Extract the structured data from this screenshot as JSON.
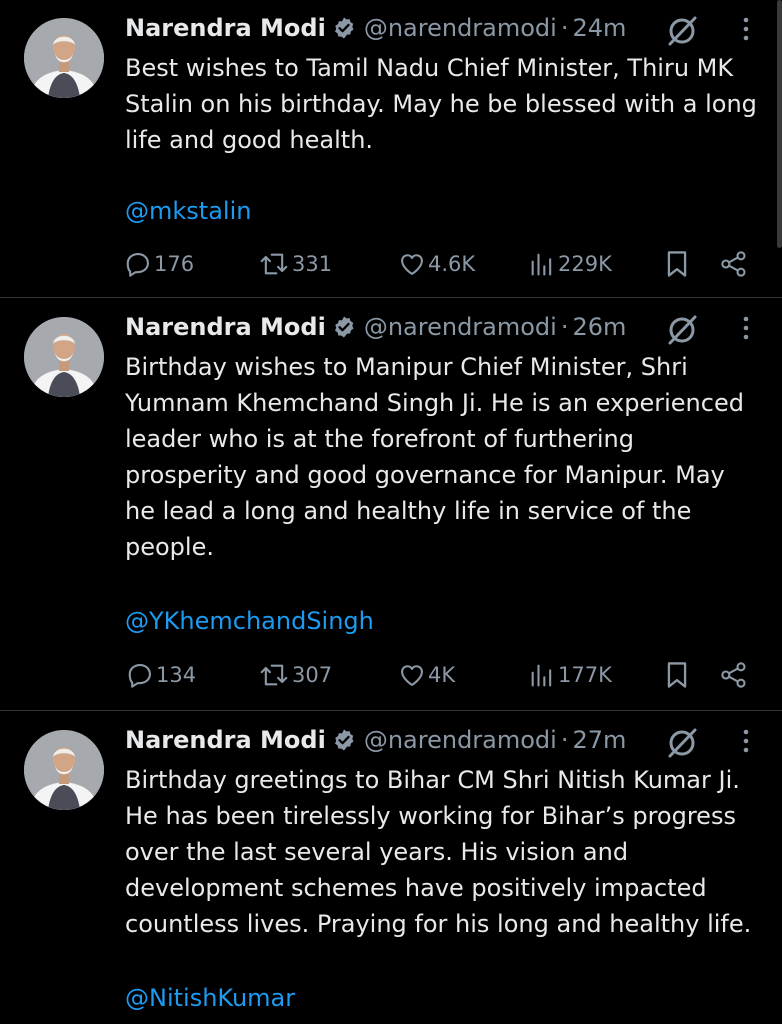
{
  "tweets": [
    {
      "author_name": "Narendra Modi",
      "handle": "@narendramodi",
      "separator": "·",
      "time": "24m",
      "text": "Best wishes to Tamil Nadu Chief Minister, Thiru MK\nStalin on his birthday. May he be blessed with a long\nlife and good health.",
      "mention": "@mkstalin",
      "replies": "176",
      "reposts": "331",
      "likes": "4.6K",
      "views": "229K"
    },
    {
      "author_name": "Narendra Modi",
      "handle": "@narendramodi",
      "separator": "·",
      "time": "26m",
      "text": "Birthday wishes to Manipur Chief Minister, Shri\nYumnam Khemchand Singh Ji. He is an experienced\nleader who is at the forefront of furthering\nprosperity and good governance for Manipur. May\nhe lead a long and healthy life in service of the\npeople.",
      "mention": "@YKhemchandSingh",
      "replies": "134",
      "reposts": "307",
      "likes": "4K",
      "views": "177K"
    },
    {
      "author_name": "Narendra Modi",
      "handle": "@narendramodi",
      "separator": "·",
      "time": "27m",
      "text": "Birthday greetings to Bihar CM Shri Nitish Kumar Ji.\nHe has been tirelessly working for Bihar’s progress\nover the last several years. His vision and\ndevelopment schemes have positively impacted\ncountless lives. Praying for his long and healthy life.",
      "mention": "@NitishKumar"
    }
  ],
  "colors": {
    "background": "#000000",
    "text": "#e7e9ea",
    "muted": "#8b98a5",
    "link": "#1d9bf0",
    "divider": "#2f3336"
  },
  "icons": [
    "verified-badge-icon",
    "grok-icon",
    "more-icon",
    "reply-icon",
    "repost-icon",
    "like-icon",
    "views-icon",
    "bookmark-icon",
    "share-icon"
  ]
}
